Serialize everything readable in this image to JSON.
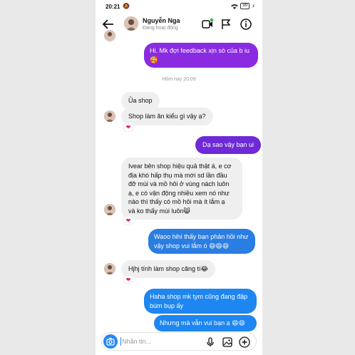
{
  "status_bar": {
    "time": "20:21",
    "battery": "99"
  },
  "header": {
    "contact_name": "Nguyễn Nga",
    "contact_status": "Đang hoạt động"
  },
  "timestamp": "Hôm nay 20:09",
  "messages": [
    {
      "text": "Hi. Mk đợi feedback xịn sò của b iu 🥰",
      "line1": "Hi. Mk đợi feedback xịn sò của b iu",
      "line2": "🥰"
    },
    {
      "text": "Ủa shop"
    },
    {
      "text": "Shop làm ăn kiểu gì vậy ạ?"
    },
    {
      "text": "Dạ sao vậy bạn ui"
    },
    {
      "text": "Ivear bên shop hiệu quả thật á, e cơ địa khó hấp thụ mà mới sd lần đầu đỡ mùi và mồ hôi ở vùng nách luôn ạ, e có vận động nhiều xem nó như nào thì thấy có mồ hôi mà ít lắm ạ và ko thấy mùi luôn😸",
      "lines": [
        "Ivear bên shop hiệu quả thật á, e cơ",
        "địa khó hấp thụ mà mới sd lần đầu",
        "đỡ mùi và mồ hôi ở vùng nách luôn",
        "ạ, e có vận động nhiều xem nó như",
        "nào thì thấy có mồ hôi mà ít lắm ạ",
        "và ko thấy mùi luôn😸"
      ]
    },
    {
      "text": "Waoo hihi thấy bạn phản hồi như vậy shop vui lắm ó 😄😄😄",
      "line1": "Waoo hihi thấy bạn phản hồi như",
      "line2": "vậy shop vui lắm ó 😄😄😄"
    },
    {
      "text": "Hjhj tính làm shop căng tí😂"
    },
    {
      "text": "Haha shop mk tym cũng đang đập bùm bụp ấy",
      "line1": "Haha shop mk tym cũng đang đập",
      "line2": "bùm bụp ấy"
    },
    {
      "text": "Nhưng mà vẫn vui bạn ạ 😄😄"
    }
  ],
  "reaction": "❤",
  "composer": {
    "placeholder": "Nhắn tin..."
  },
  "icons": [
    "back-arrow-icon",
    "video-call-icon",
    "flag-icon",
    "info-icon",
    "camera-icon",
    "microphone-icon",
    "gallery-icon",
    "plus-icon",
    "mute-icon",
    "wifi-icon",
    "battery-icon"
  ],
  "colors": {
    "accent_blue": "#2a86f2",
    "purple": "#8a2be2",
    "heart": "#e0245e"
  }
}
